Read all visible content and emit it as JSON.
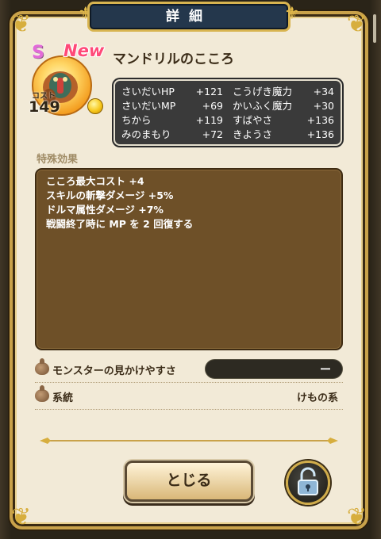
{
  "header": {
    "title": "詳細"
  },
  "monster": {
    "rank": "S",
    "new_badge": "New",
    "name": "マンドリルのこころ",
    "cost_label": "コスト",
    "cost": "149"
  },
  "stats": [
    {
      "label": "さいだいHP",
      "value": "+121"
    },
    {
      "label": "こうげき魔力",
      "value": "+34"
    },
    {
      "label": "さいだいMP",
      "value": "+69"
    },
    {
      "label": "かいふく魔力",
      "value": "+30"
    },
    {
      "label": "ちから",
      "value": "+119"
    },
    {
      "label": "すばやさ",
      "value": "+136"
    },
    {
      "label": "みのまもり",
      "value": "+72"
    },
    {
      "label": "きようさ",
      "value": "+136"
    }
  ],
  "special_effects": {
    "title": "特殊効果",
    "lines": [
      "こころ最大コスト +4",
      "スキルの斬撃ダメージ +5%",
      "ドルマ属性ダメージ +7%",
      "戦闘終了時に MP を 2 回復する"
    ]
  },
  "info": {
    "look_label": "モンスターの見かけやすさ",
    "look_value": "ー",
    "lineage_label": "系統",
    "lineage_value": "けもの系"
  },
  "buttons": {
    "close": "とじる"
  },
  "icons": {
    "lock": "unlock-icon",
    "coin": "coin-icon",
    "drop": "droplet-icon"
  },
  "colors": {
    "panel": "#f2ead7",
    "frame_gold": "#c9a24a",
    "banner": "#24374c",
    "stats_bg": "#3a3a3a",
    "effects_bg": "#6e5028",
    "new_badge": "#ff4a78",
    "rank_s": "#e36ad8"
  }
}
